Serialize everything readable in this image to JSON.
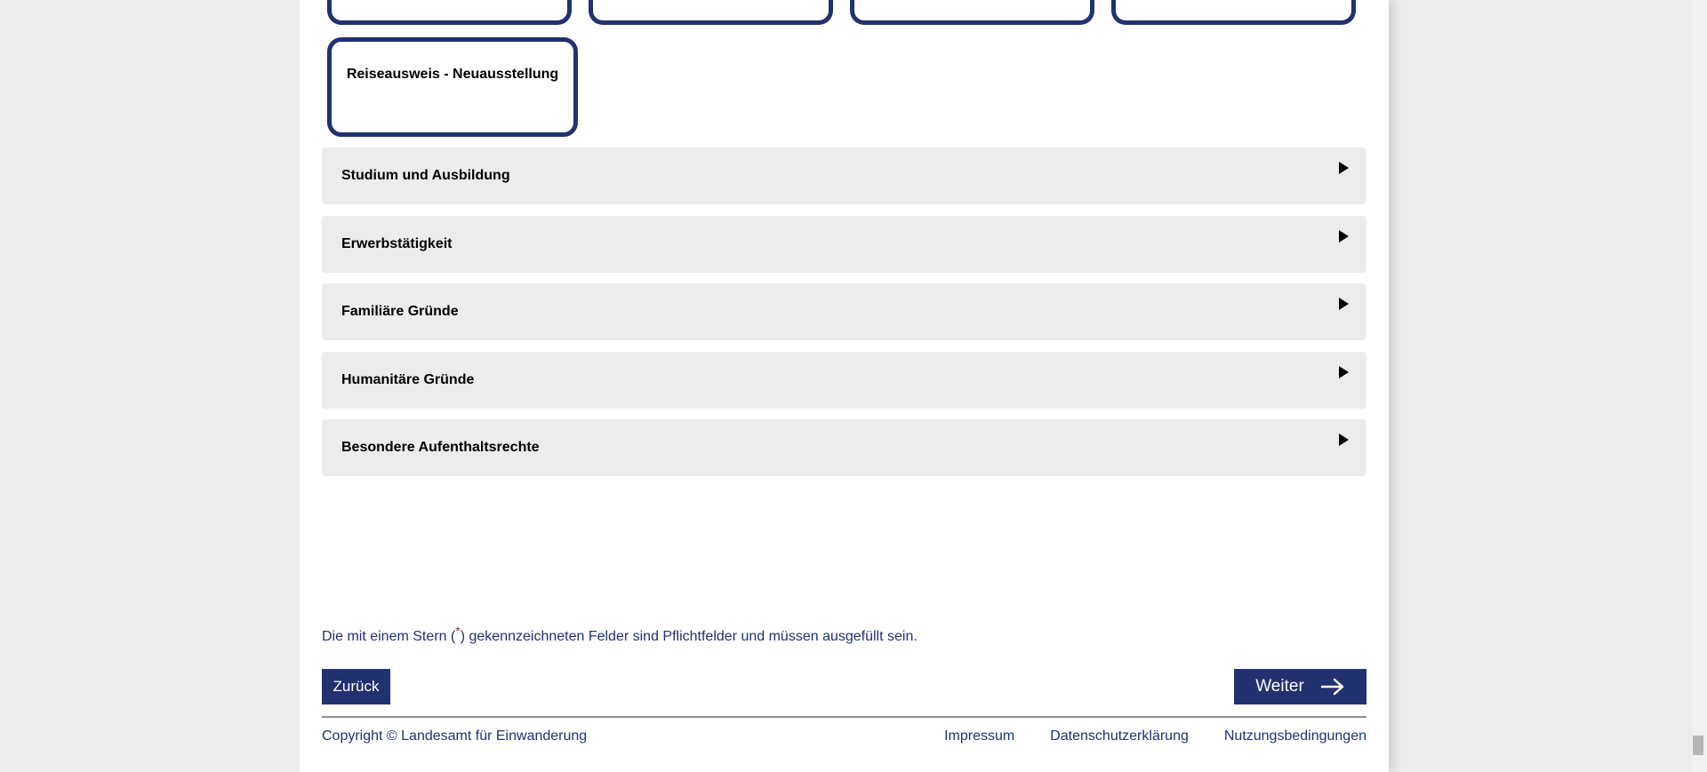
{
  "tiles": {
    "featured_label": "Reiseausweis - Neuausstellung"
  },
  "accordion": [
    {
      "label": "Studium und Ausbildung"
    },
    {
      "label": "Erwerbstätigkeit"
    },
    {
      "label": "Familiäre Gründe"
    },
    {
      "label": "Humanitäre Gründe"
    },
    {
      "label": "Besondere Aufenthaltsrechte"
    }
  ],
  "note": {
    "prefix": "Die mit einem Stern (",
    "star": "*",
    "suffix": ") gekennzeichneten Felder sind Pflichtfelder und müssen ausgefüllt sein."
  },
  "buttons": {
    "back": "Zurück",
    "next": "Weiter"
  },
  "footer": {
    "copyright": "Copyright © Landesamt für Einwanderung",
    "links": [
      "Impressum",
      "Datenschutzerklärung",
      "Nutzungsbedingungen"
    ]
  },
  "colors": {
    "brand": "#223170",
    "accordion_bg": "#ececec",
    "required_star": "#c8102e"
  }
}
